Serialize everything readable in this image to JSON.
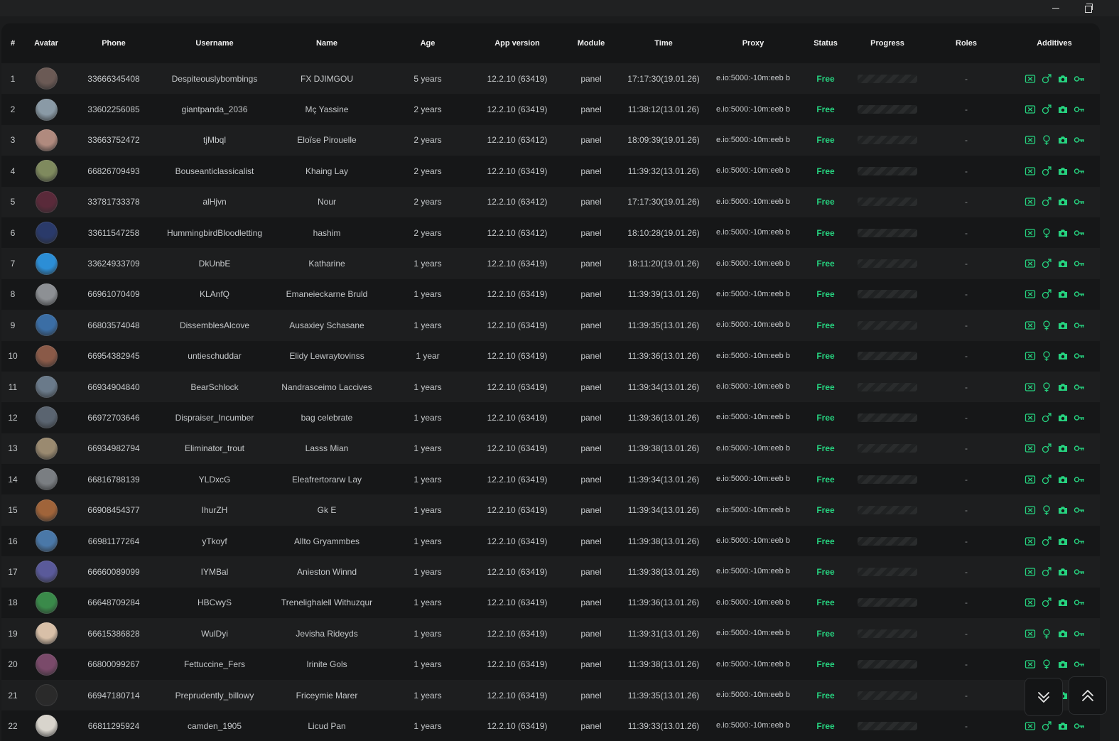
{
  "colors": {
    "accent": "#26d27f",
    "background": "#151617",
    "row_alt": "#1d1e1f"
  },
  "window": {
    "minimize_icon": "minimize-icon",
    "maximize_icon": "restore-icon"
  },
  "table": {
    "headers": {
      "num": "#",
      "avatar": "Avatar",
      "phone": "Phone",
      "username": "Username",
      "name": "Name",
      "age": "Age",
      "app_version": "App version",
      "module": "Module",
      "time": "Time",
      "proxy": "Proxy",
      "status": "Status",
      "progress": "Progress",
      "roles": "Roles",
      "additives": "Additives"
    },
    "rows": [
      {
        "num": "1",
        "phone": "33666345408",
        "username": "Despiteouslybombings",
        "name": "FX DJIMGOU",
        "age": "5 years",
        "app": "12.2.10 (63419)",
        "module": "panel",
        "time": "17:17:30(19.01.26)",
        "proxy": "e.io:5000:-10m:eeb b",
        "status": "Free",
        "progress": 0,
        "roles": "-",
        "gender": "male",
        "avatar_color": "#6b5a55"
      },
      {
        "num": "2",
        "phone": "33602256085",
        "username": "giantpanda_2036",
        "name": "Mç Yassine",
        "age": "2 years",
        "app": "12.2.10 (63419)",
        "module": "panel",
        "time": "11:38:12(13.01.26)",
        "proxy": "e.io:5000:-10m:eeb b",
        "status": "Free",
        "progress": 0,
        "roles": "-",
        "gender": "male",
        "avatar_color": "#8a9aa6"
      },
      {
        "num": "3",
        "phone": "33663752472",
        "username": "tjMbql",
        "name": "Eloïse Pirouelle",
        "age": "2 years",
        "app": "12.2.10 (63412)",
        "module": "panel",
        "time": "18:09:39(19.01.26)",
        "proxy": "e.io:5000:-10m:eeb b",
        "status": "Free",
        "progress": 0,
        "roles": "-",
        "gender": "female",
        "avatar_color": "#b08a7e"
      },
      {
        "num": "4",
        "phone": "66826709493",
        "username": "Bouseanticlassicalist",
        "name": "Khaing Lay",
        "age": "2 years",
        "app": "12.2.10 (63419)",
        "module": "panel",
        "time": "11:39:32(13.01.26)",
        "proxy": "e.io:5000:-10m:eeb b",
        "status": "Free",
        "progress": 0,
        "roles": "-",
        "gender": "male",
        "avatar_color": "#7f8a5e"
      },
      {
        "num": "5",
        "phone": "33781733378",
        "username": "alHjvn",
        "name": "Nour",
        "age": "2 years",
        "app": "12.2.10 (63412)",
        "module": "panel",
        "time": "17:17:30(19.01.26)",
        "proxy": "e.io:5000:-10m:eeb b",
        "status": "Free",
        "progress": 0,
        "roles": "-",
        "gender": "male",
        "avatar_color": "#5a2a3a"
      },
      {
        "num": "6",
        "phone": "33611547258",
        "username": "HummingbirdBloodletting",
        "name": "hashim",
        "age": "2 years",
        "app": "12.2.10 (63412)",
        "module": "panel",
        "time": "18:10:28(19.01.26)",
        "proxy": "e.io:5000:-10m:eeb b",
        "status": "Free",
        "progress": 0,
        "roles": "-",
        "gender": "female",
        "avatar_color": "#2a3a6a"
      },
      {
        "num": "7",
        "phone": "33624933709",
        "username": "DkUnbE",
        "name": "Katharine",
        "age": "1 years",
        "app": "12.2.10 (63419)",
        "module": "panel",
        "time": "18:11:20(19.01.26)",
        "proxy": "e.io:5000:-10m:eeb b",
        "status": "Free",
        "progress": 0,
        "roles": "-",
        "gender": "male",
        "avatar_color": "#2c8ed6"
      },
      {
        "num": "8",
        "phone": "66961070409",
        "username": "KLAnfQ",
        "name": "Emaneieckarne Bruld",
        "age": "1 years",
        "app": "12.2.10 (63419)",
        "module": "panel",
        "time": "11:39:39(13.01.26)",
        "proxy": "e.io:5000:-10m:eeb b",
        "status": "Free",
        "progress": 0,
        "roles": "-",
        "gender": "male",
        "avatar_color": "#8d9094"
      },
      {
        "num": "9",
        "phone": "66803574048",
        "username": "DissemblesAlcove",
        "name": "Ausaxiey Schasane",
        "age": "1 years",
        "app": "12.2.10 (63419)",
        "module": "panel",
        "time": "11:39:35(13.01.26)",
        "proxy": "e.io:5000:-10m:eeb b",
        "status": "Free",
        "progress": 0,
        "roles": "-",
        "gender": "female",
        "avatar_color": "#3b6ea5"
      },
      {
        "num": "10",
        "phone": "66954382945",
        "username": "untieschuddar",
        "name": "Elidy Lewraytovinss",
        "age": "1 year",
        "app": "12.2.10 (63419)",
        "module": "panel",
        "time": "11:39:36(13.01.26)",
        "proxy": "e.io:5000:-10m:eeb b",
        "status": "Free",
        "progress": 0,
        "roles": "-",
        "gender": "female",
        "avatar_color": "#8a5a48"
      },
      {
        "num": "11",
        "phone": "66934904840",
        "username": "BearSchlock",
        "name": "Nandrasceimo Laccives",
        "age": "1 years",
        "app": "12.2.10 (63419)",
        "module": "panel",
        "time": "11:39:34(13.01.26)",
        "proxy": "e.io:5000:-10m:eeb b",
        "status": "Free",
        "progress": 0,
        "roles": "-",
        "gender": "female",
        "avatar_color": "#6a7a8a"
      },
      {
        "num": "12",
        "phone": "66972703646",
        "username": "Dispraiser_Incumber",
        "name": "bag celebrate",
        "age": "1 years",
        "app": "12.2.10 (63419)",
        "module": "panel",
        "time": "11:39:36(13.01.26)",
        "proxy": "e.io:5000:-10m:eeb b",
        "status": "Free",
        "progress": 0,
        "roles": "-",
        "gender": "male",
        "avatar_color": "#5a6470"
      },
      {
        "num": "13",
        "phone": "66934982794",
        "username": "Eliminator_trout",
        "name": "Lasss Mian",
        "age": "1 years",
        "app": "12.2.10 (63419)",
        "module": "panel",
        "time": "11:39:38(13.01.26)",
        "proxy": "e.io:5000:-10m:eeb b",
        "status": "Free",
        "progress": 0,
        "roles": "-",
        "gender": "male",
        "avatar_color": "#9a8a70"
      },
      {
        "num": "14",
        "phone": "66816788139",
        "username": "YLDxcG",
        "name": "Eleafrertorarw Lay",
        "age": "1 years",
        "app": "12.2.10 (63419)",
        "module": "panel",
        "time": "11:39:34(13.01.26)",
        "proxy": "e.io:5000:-10m:eeb b",
        "status": "Free",
        "progress": 0,
        "roles": "-",
        "gender": "male",
        "avatar_color": "#7a7e82"
      },
      {
        "num": "15",
        "phone": "66908454377",
        "username": "IhurZH",
        "name": "Gk E",
        "age": "1 years",
        "app": "12.2.10 (63419)",
        "module": "panel",
        "time": "11:39:34(13.01.26)",
        "proxy": "e.io:5000:-10m:eeb b",
        "status": "Free",
        "progress": 0,
        "roles": "-",
        "gender": "female",
        "avatar_color": "#a0643a"
      },
      {
        "num": "16",
        "phone": "66981177264",
        "username": "yTkoyf",
        "name": "Allto Gryammbes",
        "age": "1 years",
        "app": "12.2.10 (63419)",
        "module": "panel",
        "time": "11:39:38(13.01.26)",
        "proxy": "e.io:5000:-10m:eeb b",
        "status": "Free",
        "progress": 0,
        "roles": "-",
        "gender": "male",
        "avatar_color": "#4a78a8"
      },
      {
        "num": "17",
        "phone": "66660089099",
        "username": "IYMBal",
        "name": "Anieston Winnd",
        "age": "1 years",
        "app": "12.2.10 (63419)",
        "module": "panel",
        "time": "11:39:38(13.01.26)",
        "proxy": "e.io:5000:-10m:eeb b",
        "status": "Free",
        "progress": 0,
        "roles": "-",
        "gender": "male",
        "avatar_color": "#5a5a9a"
      },
      {
        "num": "18",
        "phone": "66648709284",
        "username": "HBCwyS",
        "name": "Trenelighalell Withuzqur",
        "age": "1 years",
        "app": "12.2.10 (63419)",
        "module": "panel",
        "time": "11:39:36(13.01.26)",
        "proxy": "e.io:5000:-10m:eeb b",
        "status": "Free",
        "progress": 0,
        "roles": "-",
        "gender": "male",
        "avatar_color": "#3a8a4a"
      },
      {
        "num": "19",
        "phone": "66615386828",
        "username": "WulDyi",
        "name": "Jevisha Rideyds",
        "age": "1 years",
        "app": "12.2.10 (63419)",
        "module": "panel",
        "time": "11:39:31(13.01.26)",
        "proxy": "e.io:5000:-10m:eeb b",
        "status": "Free",
        "progress": 0,
        "roles": "-",
        "gender": "female",
        "avatar_color": "#d8c0a8"
      },
      {
        "num": "20",
        "phone": "66800099267",
        "username": "Fettuccine_Fers",
        "name": "Irinite Gols",
        "age": "1 years",
        "app": "12.2.10 (63419)",
        "module": "panel",
        "time": "11:39:38(13.01.26)",
        "proxy": "e.io:5000:-10m:eeb b",
        "status": "Free",
        "progress": 0,
        "roles": "-",
        "gender": "female",
        "avatar_color": "#7a4a6a"
      },
      {
        "num": "21",
        "phone": "66947180714",
        "username": "Preprudently_billowy",
        "name": "Friceymie Marer",
        "age": "1 years",
        "app": "12.2.10 (63419)",
        "module": "panel",
        "time": "11:39:35(13.01.26)",
        "proxy": "e.io:5000:-10m:eeb b",
        "status": "Free",
        "progress": 0,
        "roles": "-",
        "gender": "male",
        "avatar_color": "#2a2a2a"
      },
      {
        "num": "22",
        "phone": "66811295924",
        "username": "camden_1905",
        "name": "Licud Pan",
        "age": "1 years",
        "app": "12.2.10 (63419)",
        "module": "panel",
        "time": "11:39:33(13.01.26)",
        "proxy": "e.io:5000:-10m:eeb b",
        "status": "Free",
        "progress": 0,
        "roles": "-",
        "gender": "male",
        "avatar_color": "#d8d4cc"
      }
    ]
  },
  "scroll": {
    "down_icon": "chevron-double-down-icon",
    "up_icon": "chevron-up-icon"
  }
}
